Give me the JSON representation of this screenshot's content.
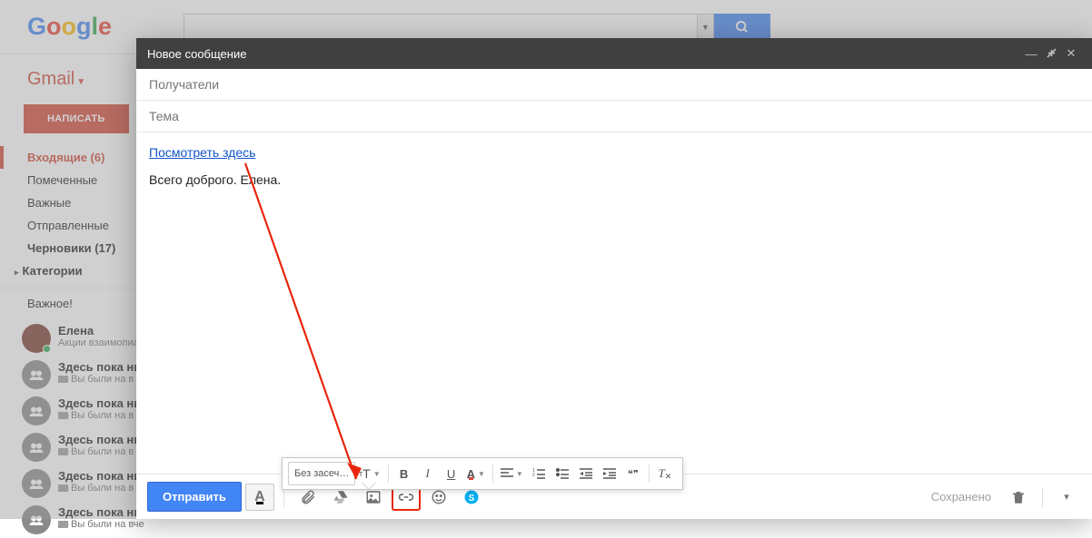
{
  "header": {
    "logo_g": "G",
    "logo_o1": "o",
    "logo_o2": "o",
    "logo_g2": "g",
    "logo_l": "l",
    "logo_e": "e",
    "search_placeholder": "",
    "search_dd": "▼"
  },
  "sidebar": {
    "brand": "Gmail",
    "compose": "НАПИСАТЬ",
    "items": [
      {
        "label": "Входящие (6)",
        "active": true
      },
      {
        "label": "Помеченные"
      },
      {
        "label": "Важные"
      },
      {
        "label": "Отправленные"
      },
      {
        "label": "Черновики (17)",
        "bold": true
      },
      {
        "label": "Категории",
        "caret": true,
        "bold": true
      },
      {
        "label": "Важное!",
        "imp": true
      }
    ],
    "contacts": [
      {
        "name": "Елена",
        "sub": "Акции взаимопиа",
        "photo": true,
        "online": true
      },
      {
        "name": "Здесь пока ни",
        "sub": "Вы были на в",
        "cam": true
      },
      {
        "name": "Здесь пока ни",
        "sub": "Вы были на в",
        "cam": true
      },
      {
        "name": "Здесь пока ни",
        "sub": "Вы были на в",
        "cam": true
      },
      {
        "name": "Здесь пока ни",
        "sub": "Вы были на в",
        "cam": true
      },
      {
        "name": "Здесь пока ни",
        "sub": "Вы были на вче",
        "cam": true
      }
    ]
  },
  "compose": {
    "title": "Новое сообщение",
    "recipients_ph": "Получатели",
    "subject_ph": "Тема",
    "body_link": "Посмотреть здесь",
    "body_text": "Всего доброго. Елена.",
    "send": "Отправить",
    "saved": "Сохранено",
    "font_name": "Без засеч…"
  },
  "icons": {
    "minimize": "—",
    "shrink": "↙",
    "close": "✕",
    "size": "тT",
    "bold": "B",
    "italic": "I",
    "underline": "U",
    "colorA": "A",
    "align": "≡",
    "numlist": "1≡",
    "bullist": "•≡",
    "outdent": "⇤",
    "indent": "⇥",
    "quote": "❝❞",
    "clear": "Tx",
    "formatA": "A",
    "emoji": "☺",
    "more": "▾"
  }
}
